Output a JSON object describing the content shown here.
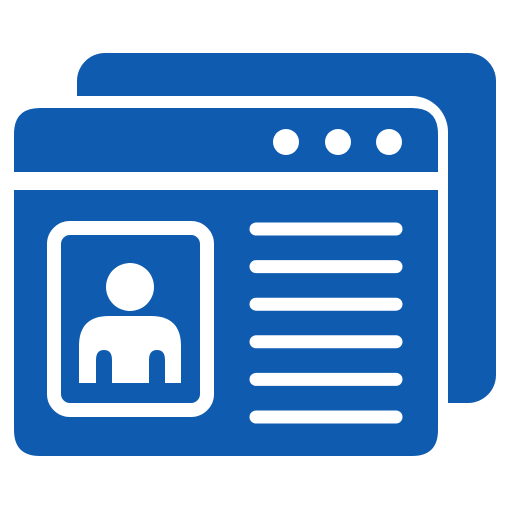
{
  "icon": {
    "name": "browser-profile-windows-icon",
    "colors": {
      "primary": "#0f5bb0",
      "foreground": "#ffffff"
    },
    "window_controls": [
      "dot",
      "dot",
      "dot"
    ],
    "profile_card": {
      "icon": "user-avatar-icon"
    },
    "text_lines_count": 6
  }
}
